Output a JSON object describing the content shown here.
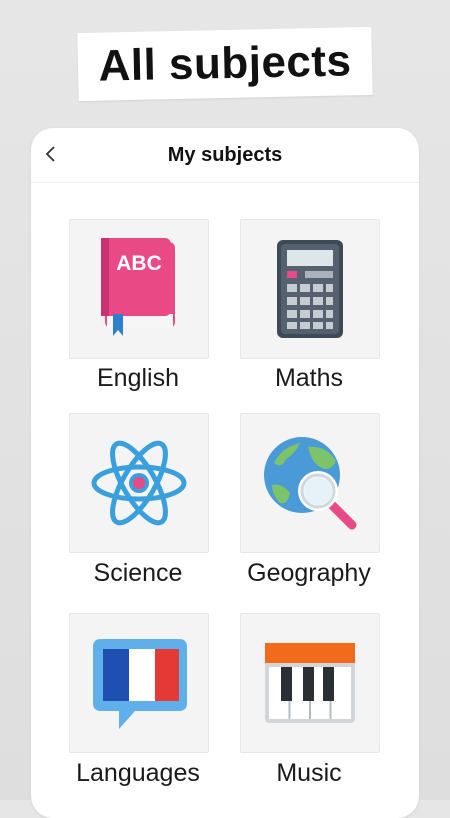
{
  "banner": {
    "text": "All subjects"
  },
  "header": {
    "title": "My subjects"
  },
  "icons": {
    "back": "chevron-left-icon"
  },
  "subjects": [
    {
      "label": "English",
      "icon": "abc-book-icon"
    },
    {
      "label": "Maths",
      "icon": "calculator-icon"
    },
    {
      "label": "Science",
      "icon": "atom-icon"
    },
    {
      "label": "Geography",
      "icon": "globe-magnifier-icon"
    },
    {
      "label": "Languages",
      "icon": "french-flag-speech-bubble-icon"
    },
    {
      "label": "Music",
      "icon": "piano-keys-icon"
    }
  ],
  "colors": {
    "book": "#e94a86",
    "atom": "#3aa0dd",
    "globe": "#4a9ad8",
    "flag_blue": "#1f4fb1",
    "flag_red": "#e53935",
    "piano_top": "#f26b1d"
  }
}
